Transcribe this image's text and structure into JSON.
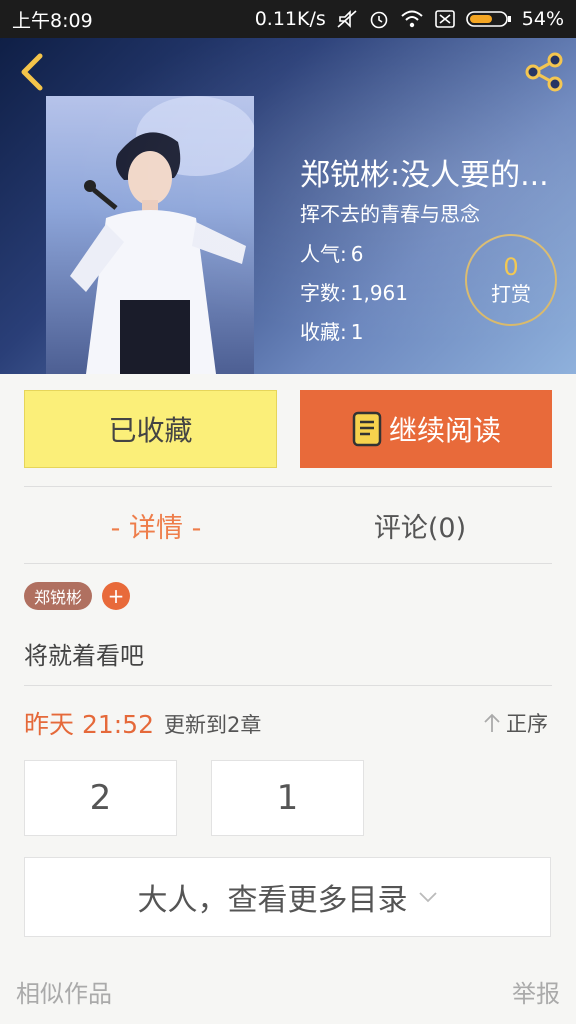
{
  "status_bar": {
    "time": "上午8:09",
    "net_speed": "0.11K/s",
    "battery": "54%"
  },
  "book": {
    "title": "郑锐彬:没人要的...",
    "subtitle": "挥不去的青春与思念",
    "stats": [
      {
        "key": "人气:",
        "value": "6"
      },
      {
        "key": "字数:",
        "value": "1,961"
      },
      {
        "key": "收藏:",
        "value": "1"
      }
    ],
    "tip_count": "0",
    "tip_label": "打赏"
  },
  "actions": {
    "collected_label": "已收藏",
    "read_label": "继续阅读"
  },
  "tabs": {
    "detail": "- 详情 -",
    "comment": "评论(0)"
  },
  "tag": "郑锐彬",
  "tag_add": "+",
  "description": "将就着看吧",
  "update": {
    "time": "昨天 21:52",
    "text": "更新到2章",
    "sort_label": "正序"
  },
  "chapters": [
    "2",
    "1"
  ],
  "more_catalog": "大人，查看更多目录",
  "footer": {
    "similar": "相似作品",
    "report": "举报"
  },
  "colors": {
    "accent": "#e86a3a",
    "collected_bg": "#fbef79",
    "tip_gold": "#f1c54b"
  },
  "icons": [
    "back-icon",
    "share-icon",
    "book-icon",
    "sort-up-icon",
    "chevron-down-icon",
    "wifi-icon",
    "alarm-icon",
    "battery-icon"
  ]
}
